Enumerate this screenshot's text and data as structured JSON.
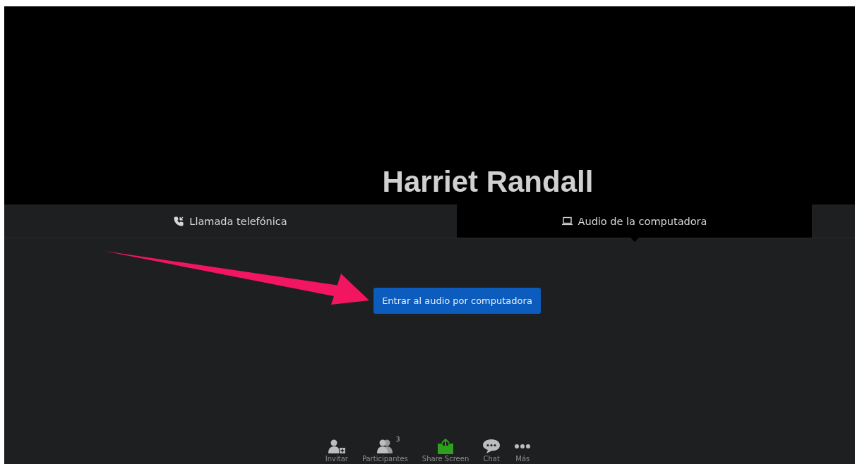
{
  "video": {
    "name": "Harriet Randall"
  },
  "tabs": [
    {
      "kind": "phone",
      "label": "Llamada telefónica",
      "selected": false
    },
    {
      "kind": "laptop",
      "label": "Audio de la computadora",
      "selected": true
    }
  ],
  "join_button": "Entrar al audio por computadora",
  "toolbar": [
    {
      "kind": "invite",
      "label": "Invitar"
    },
    {
      "kind": "participants",
      "label": "Participantes",
      "badge": "3"
    },
    {
      "kind": "share",
      "label": "Share Screen"
    },
    {
      "kind": "chat",
      "label": "Chat"
    },
    {
      "kind": "more",
      "label": "Más"
    }
  ]
}
